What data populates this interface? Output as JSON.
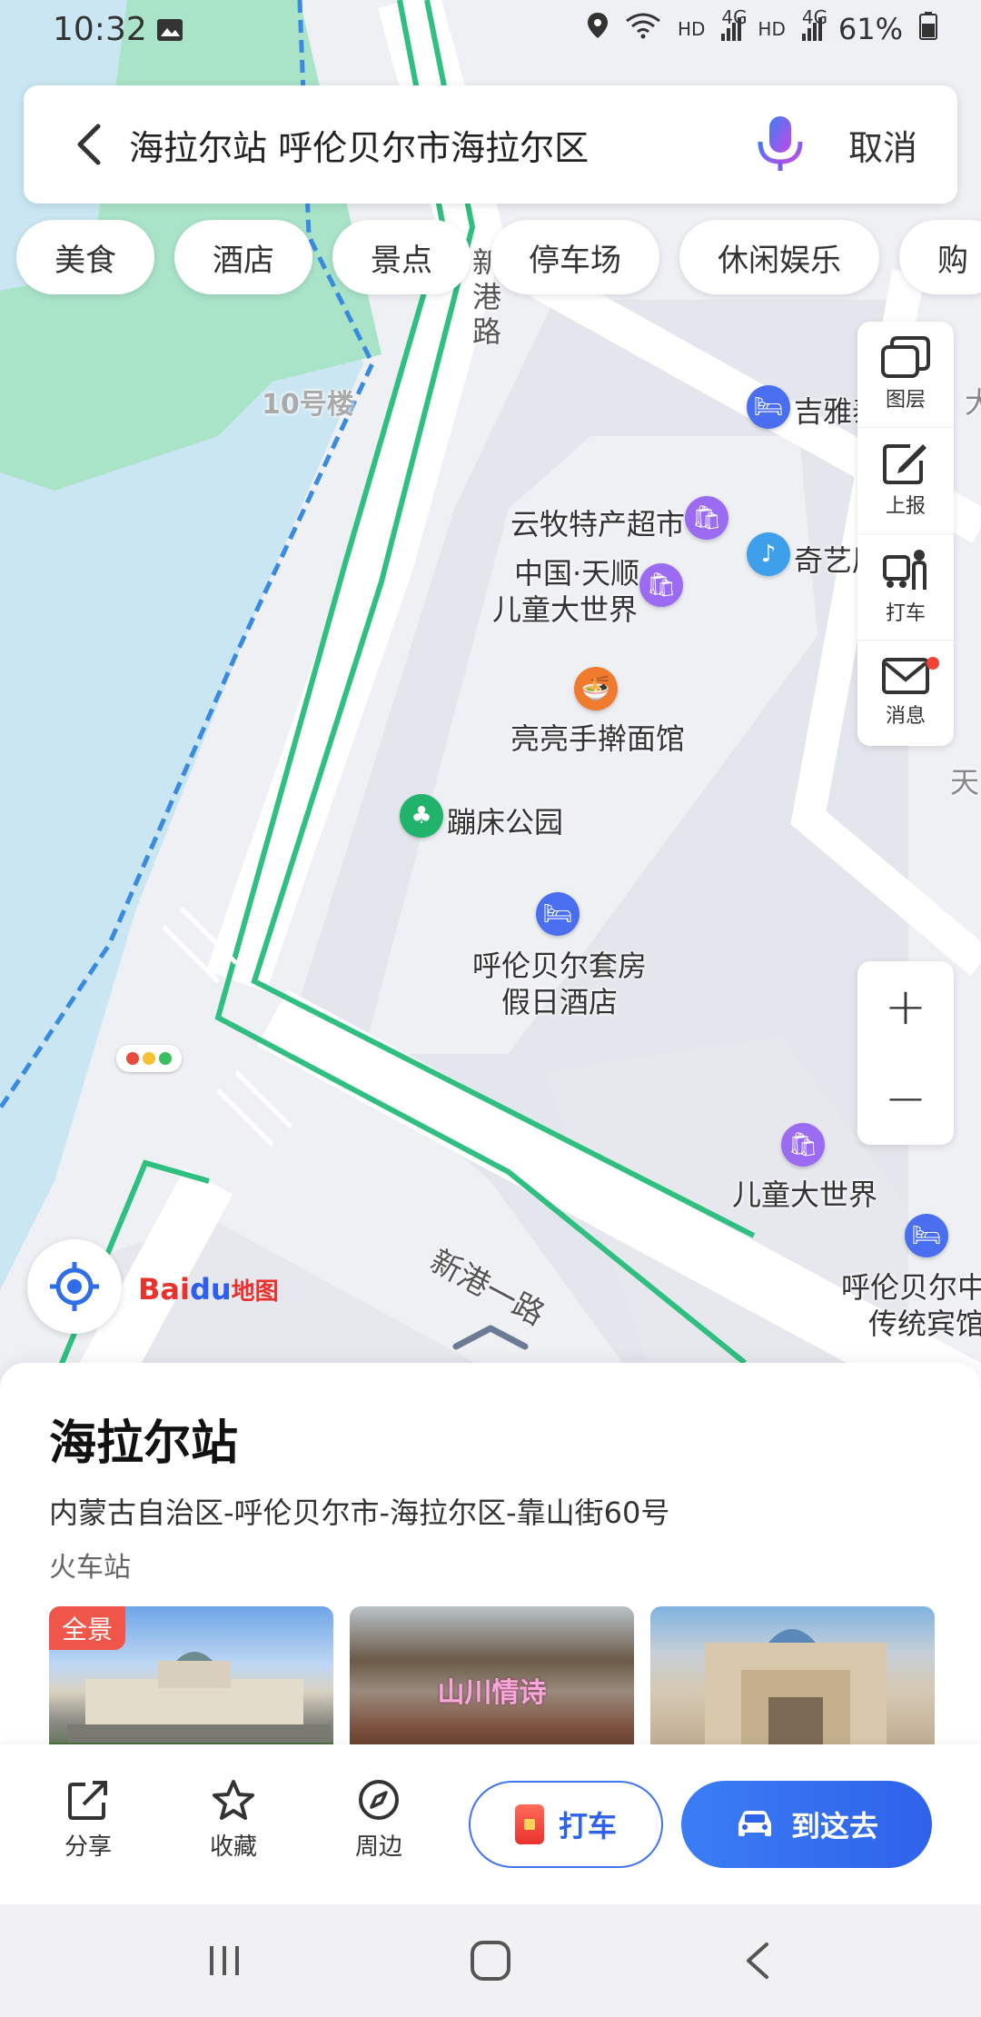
{
  "status_bar": {
    "time": "10:32",
    "hd1": "HD",
    "net1": "4G",
    "hd2": "HD",
    "net2": "4G",
    "battery": "61%"
  },
  "search": {
    "query": "海拉尔站 呼伦贝尔市海拉尔区",
    "cancel": "取消"
  },
  "categories": [
    "美食",
    "酒店",
    "景点",
    "停车场",
    "休闲娱乐",
    "购"
  ],
  "map": {
    "road_xingang": "新港路",
    "road_xingang_yi": "新港一路",
    "building_10": "10号楼",
    "pois": {
      "jiya": "吉雅泰",
      "yunmu": "云牧特产超市",
      "qiyi": "奇艺屋",
      "tianshun_line1": "中国·天顺",
      "tianshun_line2": "儿童大世界",
      "liangliang": "亮亮手擀面馆",
      "bengchuang": "蹦床公园",
      "hotel_line1": "呼伦贝尔套房",
      "hotel_line2": "假日酒店",
      "kids_world": "儿童大世界",
      "hotel2_line1": "呼伦贝尔中",
      "hotel2_line2": "传统宾馆",
      "tian": "天",
      "da": "大"
    }
  },
  "tools": {
    "layers": "图层",
    "report": "上报",
    "taxi": "打车",
    "messages": "消息"
  },
  "zoom": {
    "in": "+",
    "out": "−"
  },
  "logo": {
    "bai": "Bai",
    "du": "du",
    "ditu": "地图"
  },
  "place": {
    "name": "海拉尔站",
    "address": "内蒙古自治区-呼伦贝尔市-海拉尔区-靠山街60号",
    "type": "火车站",
    "photo_badge": "全景",
    "photo_caption": "山川情诗"
  },
  "actions": {
    "share": "分享",
    "favorite": "收藏",
    "nearby": "周边",
    "taxi": "打车",
    "go": "到这去"
  },
  "colors": {
    "primary": "#2f62ea",
    "road_green": "#2fbf80",
    "water": "#c9e6f2",
    "park": "#a7e3c6"
  }
}
